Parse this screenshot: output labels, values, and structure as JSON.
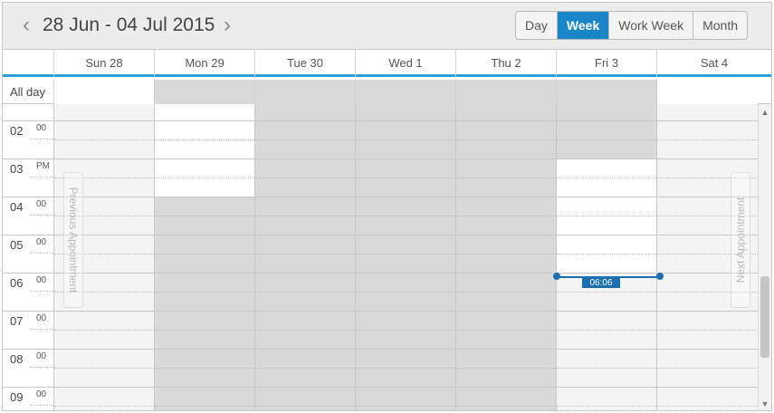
{
  "toolbar": {
    "prev_icon": "chevron-left-icon",
    "next_icon": "chevron-right-icon",
    "date_range": "28 Jun - 04 Jul 2015",
    "views": [
      "Day",
      "Week",
      "Work Week",
      "Month"
    ],
    "active_view": "Week"
  },
  "days": [
    "Sun 28",
    "Mon 29",
    "Tue 30",
    "Wed 1",
    "Thu 2",
    "Fri 3",
    "Sat 4"
  ],
  "allday_label": "All day",
  "hours": [
    {
      "hour": "02",
      "min": "00"
    },
    {
      "hour": "03",
      "min": "PM"
    },
    {
      "hour": "04",
      "min": "00"
    },
    {
      "hour": "05",
      "min": "00"
    },
    {
      "hour": "06",
      "min": "00"
    },
    {
      "hour": "07",
      "min": "00"
    },
    {
      "hour": "08",
      "min": "00"
    },
    {
      "hour": "09",
      "min": "00"
    }
  ],
  "nav": {
    "previous": "Previous Appointment",
    "next": "Next Appointment"
  },
  "current_time": "06:06",
  "colors": {
    "accent": "#1a86c8",
    "time_marker": "#1a6fb0",
    "busy": "#d9d9d9",
    "off": "#f3f4f3"
  }
}
